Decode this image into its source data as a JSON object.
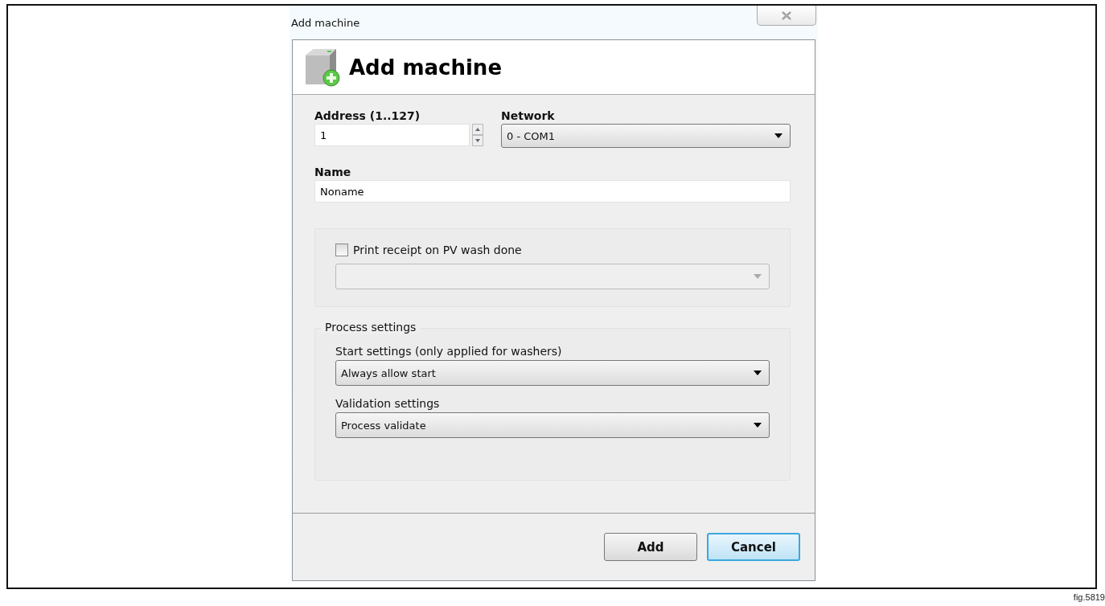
{
  "window": {
    "title": "Add machine"
  },
  "header": {
    "title": "Add machine"
  },
  "address": {
    "label": "Address (1..127)",
    "value": "1"
  },
  "network": {
    "label": "Network",
    "value": "0 - COM1"
  },
  "name": {
    "label": "Name",
    "value": "Noname"
  },
  "print_receipt": {
    "label": "Print receipt on PV wash done",
    "checked": false,
    "dropdown_disabled": true
  },
  "process_settings": {
    "legend": "Process settings",
    "fields": [
      {
        "label": "Start settings (only applied for washers)",
        "value": "Always allow start"
      },
      {
        "label": "Validation settings",
        "value": "Process validate"
      }
    ]
  },
  "buttons": [
    {
      "label": "Add",
      "focused": false
    },
    {
      "label": "Cancel",
      "focused": true
    }
  ],
  "figure_label": "fig.5819"
}
